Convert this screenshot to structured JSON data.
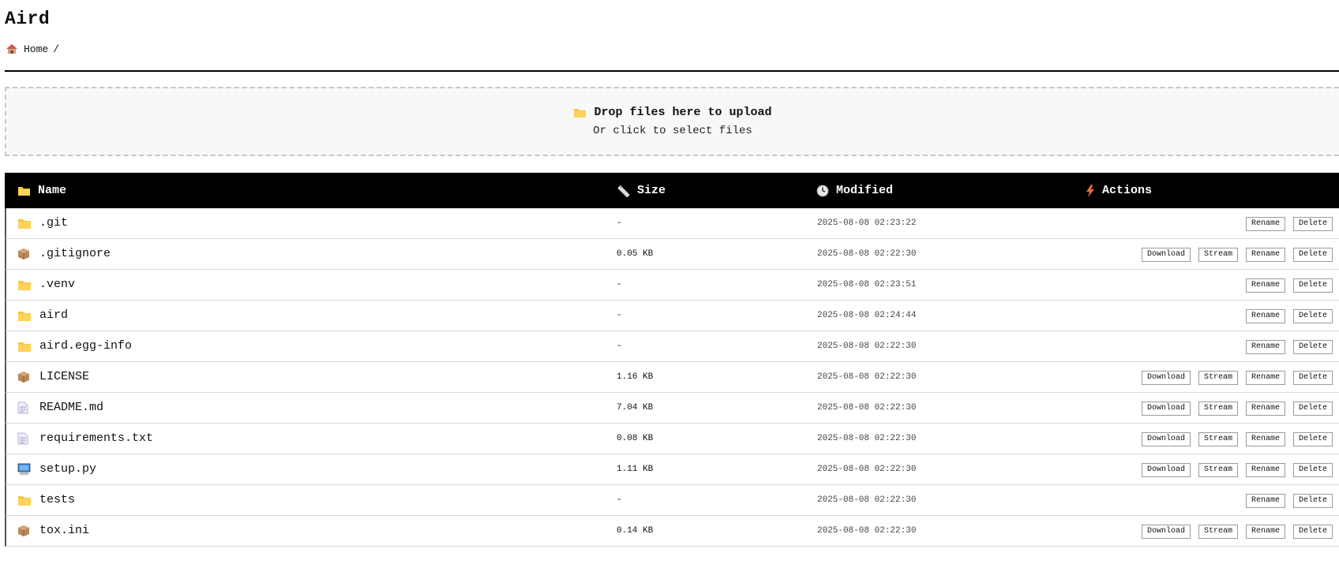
{
  "app": {
    "title": "Aird"
  },
  "breadcrumb": {
    "home_label": "Home",
    "separator": "/"
  },
  "dropzone": {
    "primary": "Drop files here to upload",
    "secondary": "Or click to select files"
  },
  "table": {
    "headers": {
      "name": "Name",
      "size": "Size",
      "modified": "Modified",
      "actions": "Actions"
    },
    "rows": [
      {
        "icon": "folder-icon",
        "name": ".git",
        "size": "-",
        "modified": "2025-08-08 02:23:22",
        "actions": [
          "Rename",
          "Delete"
        ]
      },
      {
        "icon": "package-icon",
        "name": ".gitignore",
        "size": "0.05 KB",
        "modified": "2025-08-08 02:22:30",
        "actions": [
          "Download",
          "Stream",
          "Rename",
          "Delete"
        ]
      },
      {
        "icon": "folder-icon",
        "name": ".venv",
        "size": "-",
        "modified": "2025-08-08 02:23:51",
        "actions": [
          "Rename",
          "Delete"
        ]
      },
      {
        "icon": "folder-icon",
        "name": "aird",
        "size": "-",
        "modified": "2025-08-08 02:24:44",
        "actions": [
          "Rename",
          "Delete"
        ]
      },
      {
        "icon": "folder-icon",
        "name": "aird.egg-info",
        "size": "-",
        "modified": "2025-08-08 02:22:30",
        "actions": [
          "Rename",
          "Delete"
        ]
      },
      {
        "icon": "package-icon",
        "name": "LICENSE",
        "size": "1.16 KB",
        "modified": "2025-08-08 02:22:30",
        "actions": [
          "Download",
          "Stream",
          "Rename",
          "Delete"
        ]
      },
      {
        "icon": "document-icon",
        "name": "README.md",
        "size": "7.04 KB",
        "modified": "2025-08-08 02:22:30",
        "actions": [
          "Download",
          "Stream",
          "Rename",
          "Delete"
        ]
      },
      {
        "icon": "document-icon",
        "name": "requirements.txt",
        "size": "0.08 KB",
        "modified": "2025-08-08 02:22:30",
        "actions": [
          "Download",
          "Stream",
          "Rename",
          "Delete"
        ]
      },
      {
        "icon": "computer-icon",
        "name": "setup.py",
        "size": "1.11 KB",
        "modified": "2025-08-08 02:22:30",
        "actions": [
          "Download",
          "Stream",
          "Rename",
          "Delete"
        ]
      },
      {
        "icon": "folder-icon",
        "name": "tests",
        "size": "-",
        "modified": "2025-08-08 02:22:30",
        "actions": [
          "Rename",
          "Delete"
        ]
      },
      {
        "icon": "package-icon",
        "name": "tox.ini",
        "size": "0.14 KB",
        "modified": "2025-08-08 02:22:30",
        "actions": [
          "Download",
          "Stream",
          "Rename",
          "Delete"
        ]
      }
    ]
  },
  "colors": {
    "header_bg": "#000000",
    "folder": "#f5c542",
    "actions_bolt": "#f06a3a"
  }
}
